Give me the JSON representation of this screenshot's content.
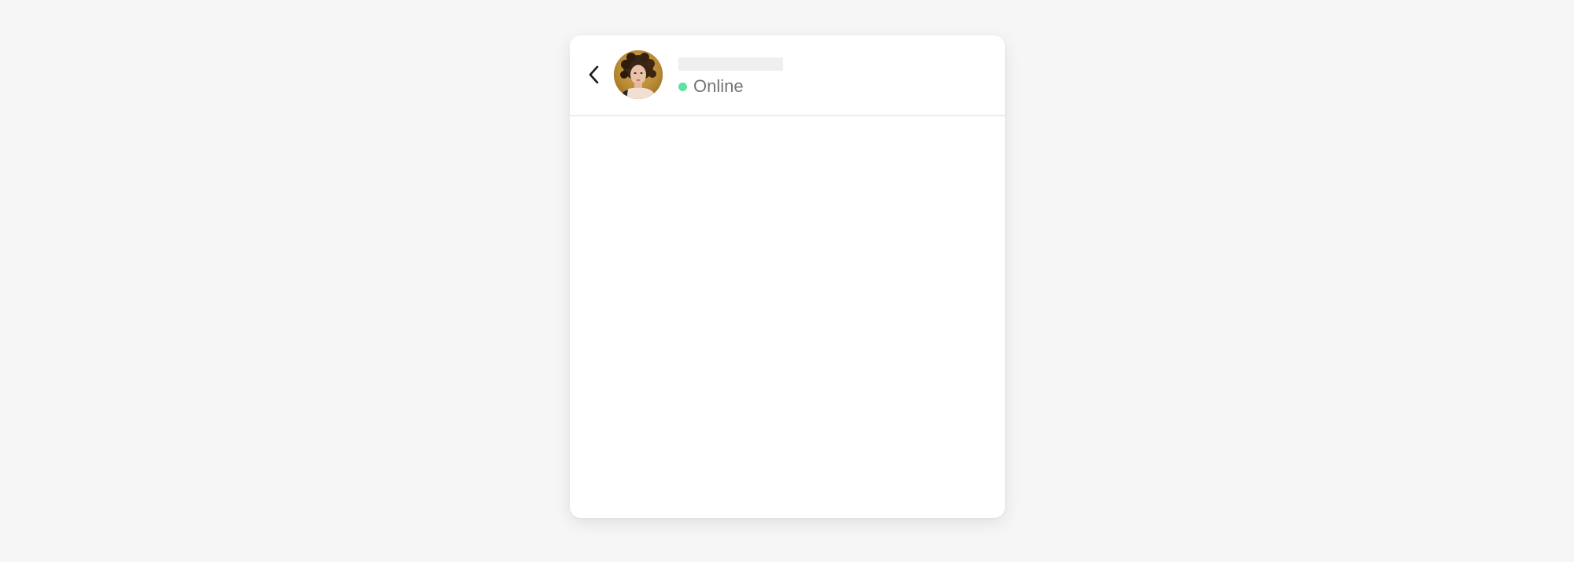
{
  "chat": {
    "back_icon": "chevron-left-icon",
    "contact": {
      "avatar_icon": "user-portrait-photo",
      "name": "",
      "status_text": "Online",
      "status_color": "#5ee2a0"
    },
    "messages": []
  },
  "colors": {
    "page_background": "#f6f6f6",
    "card_background": "#ffffff",
    "divider": "#ececec",
    "name_placeholder": "#efefef",
    "status_text": "#757575"
  }
}
